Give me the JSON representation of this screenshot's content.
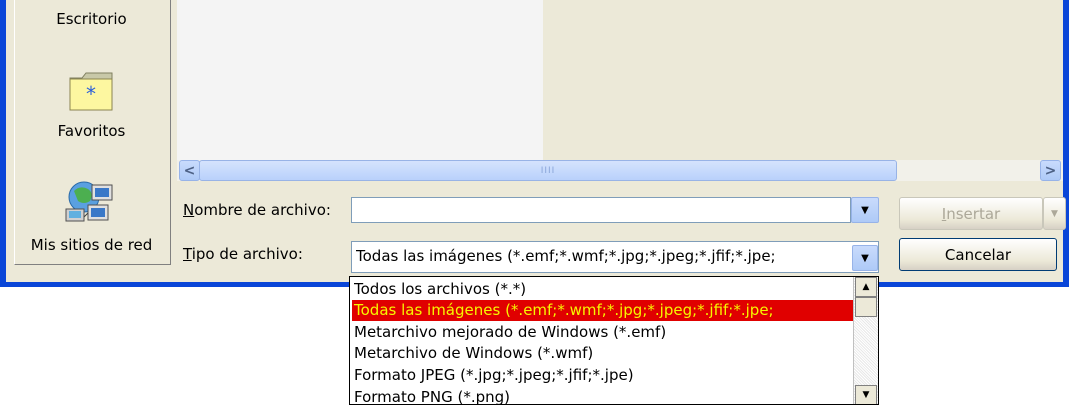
{
  "places": {
    "desktop_label": "Escritorio",
    "favorites_label": "Favoritos",
    "network_label": "Mis sitios de red"
  },
  "scrollbar": {
    "left_arrow": "<",
    "right_arrow": ">",
    "thumb_grip": "IIII"
  },
  "form": {
    "filename_label_accel": "N",
    "filename_label_rest": "ombre de archivo:",
    "filename_value": "",
    "filetype_label_accel": "T",
    "filetype_label_rest": "ipo de archivo:",
    "filetype_value": "Todas las imágenes (*.emf;*.wmf;*.jpg;*.jpeg;*.jfif;*.jpe;"
  },
  "buttons": {
    "insert_accel": "I",
    "insert_rest": "nsertar",
    "insert_split": "▼",
    "cancel": "Cancelar"
  },
  "dropdown": {
    "options": [
      "Todos los archivos (*.*)",
      "Todas las imágenes (*.emf;*.wmf;*.jpg;*.jpeg;*.jfif;*.jpe;",
      "Metarchivo mejorado de Windows (*.emf)",
      "Metarchivo de Windows (*.wmf)",
      "Formato JPEG (*.jpg;*.jpeg;*.jfif;*.jpe)",
      "Formato PNG (*.png)"
    ],
    "selected_index": 1
  },
  "colors": {
    "frame": "#0a46d8",
    "selection_bg": "#e00000",
    "selection_fg": "#f6f600"
  },
  "icons": [
    "folder-star-icon",
    "network-places-icon",
    "chevron-down-icon",
    "scroll-left-icon",
    "scroll-right-icon",
    "scroll-up-icon",
    "scroll-down-icon"
  ]
}
